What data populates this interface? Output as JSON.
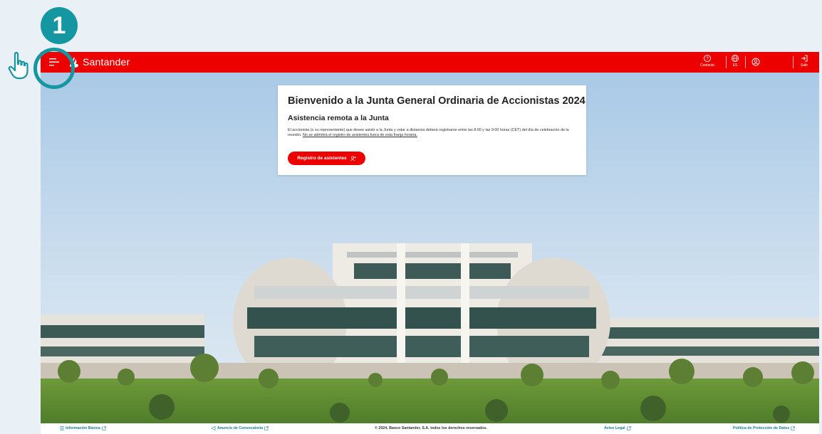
{
  "overlay": {
    "step_number": "1"
  },
  "header": {
    "brand": "Santander",
    "contact_label": "Contacto",
    "language_label": "ES",
    "logout_label": "Salir"
  },
  "card": {
    "title": "Bienvenido a la Junta General Ordinaria de Accionistas 2024",
    "subtitle": "Asistencia remota a la Junta",
    "text": "El accionista (o su representante) que desee asistir a la Junta y votar a distancia deberá registrarse entre las 8:00 y las 9:00 horas (CET) del día de celebración de la reunión.",
    "text_underlined": "No se admitirá el registro de asistentes fuera de esta franja horaria.",
    "register_button": "Registro de asistentes"
  },
  "footer": {
    "basic_info": "Información Básica",
    "announcement": "Anuncio de Convocatoria",
    "copyright": "© 2024, Banco Santander, S.A. todos los derechos reservados.",
    "legal": "Aviso Legal",
    "privacy": "Política de Protección de Datos"
  },
  "colors": {
    "brand_red": "#ec0000",
    "tutorial_teal": "#1597a1",
    "footer_link": "#1b7b8c"
  },
  "icons": [
    "menu-icon",
    "santander-flame-icon",
    "contact-icon",
    "globe-icon",
    "user-icon",
    "logout-icon",
    "external-link-icon",
    "document-icon",
    "megaphone-icon",
    "pointer-hand-icon"
  ]
}
